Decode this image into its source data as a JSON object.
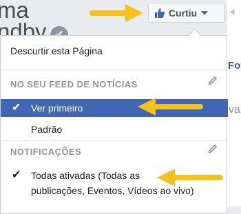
{
  "background": {
    "name_line1": "ma",
    "name_line2": "ndby",
    "fo_text": "Fo",
    "va_text": "va"
  },
  "like_button": {
    "label": "Curtiu"
  },
  "menu": {
    "unlike": "Descurtir esta Página",
    "feed_section": "NO SEU FEED DE NOTÍCIAS",
    "see_first": "Ver primeiro",
    "default": "Padrão",
    "notifications_section": "NOTIFICAÇÕES",
    "all_on_line1": "Todas ativadas (Todas as",
    "all_on_line2": "publicações, Eventos, Vídeos ao vivo)"
  },
  "icons": {
    "like": "thumbs-up-icon",
    "dropdown": "caret-down-icon",
    "edit": "pencil-icon",
    "check": "checkmark-icon",
    "verified": "verified-badge-icon",
    "annotation": "arrow-icon"
  },
  "colors": {
    "accent": "#4267b2",
    "arrow": "#f5c21b"
  }
}
